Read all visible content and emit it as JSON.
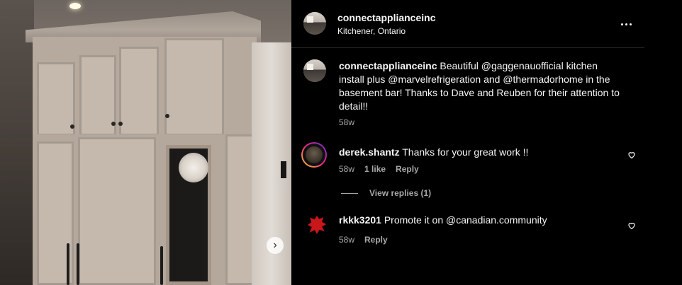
{
  "post": {
    "username": "connectapplianceinc",
    "location": "Kitchener, Ontario",
    "caption": {
      "username": "connectapplianceinc",
      "text": "Beautiful @gaggenauofficial kitchen install plus @marvelrefrigeration and @thermadorhome in the basement bar! Thanks to Dave and Reuben for their attention to detail!!",
      "time": "58w"
    },
    "icons": {
      "more": "more-options-icon",
      "next": "chevron-right-icon",
      "like": "heart-outline-icon"
    }
  },
  "comments": [
    {
      "username": "derek.shantz",
      "text": "Thanks for your great work !!",
      "time": "58w",
      "likes": "1 like",
      "reply_label": "Reply",
      "view_replies": "View replies (1)"
    },
    {
      "username": "rkkk3201",
      "text": "Promote it on @canadian.community",
      "time": "58w",
      "reply_label": "Reply"
    }
  ],
  "colors": {
    "background": "#000000",
    "text": "#f5f5f5",
    "secondary": "#a8a8a8",
    "divider": "#262626"
  }
}
